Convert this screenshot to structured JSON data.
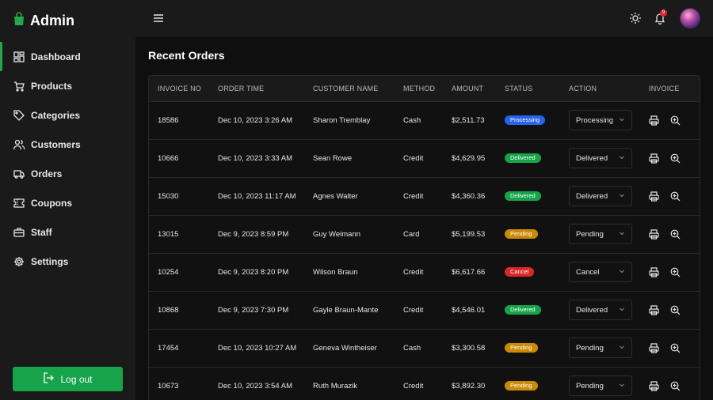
{
  "brand": {
    "name": "Admin",
    "icon": "shopping-bag-icon",
    "accent": "#22a84b"
  },
  "sidebar": {
    "items": [
      {
        "label": "Dashboard",
        "icon": "grid-icon",
        "active": true
      },
      {
        "label": "Products",
        "icon": "cart-icon"
      },
      {
        "label": "Categories",
        "icon": "tag-icon"
      },
      {
        "label": "Customers",
        "icon": "users-icon"
      },
      {
        "label": "Orders",
        "icon": "truck-icon"
      },
      {
        "label": "Coupons",
        "icon": "ticket-icon"
      },
      {
        "label": "Staff",
        "icon": "briefcase-icon"
      },
      {
        "label": "Settings",
        "icon": "gear-icon"
      }
    ],
    "logout_label": "Log out"
  },
  "header": {
    "notification_count": "9"
  },
  "main": {
    "title": "Recent Orders",
    "columns": [
      "INVOICE NO",
      "ORDER TIME",
      "CUSTOMER NAME",
      "METHOD",
      "AMOUNT",
      "STATUS",
      "ACTION",
      "INVOICE"
    ],
    "orders": [
      {
        "invoice": "18586",
        "time": "Dec 10, 2023 3:26 AM",
        "customer": "Sharon Tremblay",
        "method": "Cash",
        "amount": "$2,511.73",
        "status": "Processing",
        "status_color": "#2563eb",
        "action": "Processing"
      },
      {
        "invoice": "10666",
        "time": "Dec 10, 2023 3:33 AM",
        "customer": "Sean Rowe",
        "method": "Credit",
        "amount": "$4,629.95",
        "status": "Delivered",
        "status_color": "#16a34a",
        "action": "Delivered"
      },
      {
        "invoice": "15030",
        "time": "Dec 10, 2023 11:17 AM",
        "customer": "Agnes Walter",
        "method": "Credit",
        "amount": "$4,360.36",
        "status": "Delivered",
        "status_color": "#16a34a",
        "action": "Delivered"
      },
      {
        "invoice": "13015",
        "time": "Dec 9, 2023 8:59 PM",
        "customer": "Guy Weimann",
        "method": "Card",
        "amount": "$5,199.53",
        "status": "Pending",
        "status_color": "#ca8a04",
        "action": "Pending"
      },
      {
        "invoice": "10254",
        "time": "Dec 9, 2023 8:20 PM",
        "customer": "Wilson Braun",
        "method": "Credit",
        "amount": "$6,617.66",
        "status": "Cancel",
        "status_color": "#dc2626",
        "action": "Cancel"
      },
      {
        "invoice": "10868",
        "time": "Dec 9, 2023 7:30 PM",
        "customer": "Gayle Braun-Mante",
        "method": "Credit",
        "amount": "$4,546.01",
        "status": "Delivered",
        "status_color": "#16a34a",
        "action": "Delivered"
      },
      {
        "invoice": "17454",
        "time": "Dec 10, 2023 10:27 AM",
        "customer": "Geneva Wintheiser",
        "method": "Cash",
        "amount": "$3,300.58",
        "status": "Pending",
        "status_color": "#ca8a04",
        "action": "Pending"
      },
      {
        "invoice": "10673",
        "time": "Dec 10, 2023 3:54 AM",
        "customer": "Ruth Murazik",
        "method": "Credit",
        "amount": "$3,892.30",
        "status": "Pending",
        "status_color": "#ca8a04",
        "action": "Pending"
      }
    ]
  }
}
